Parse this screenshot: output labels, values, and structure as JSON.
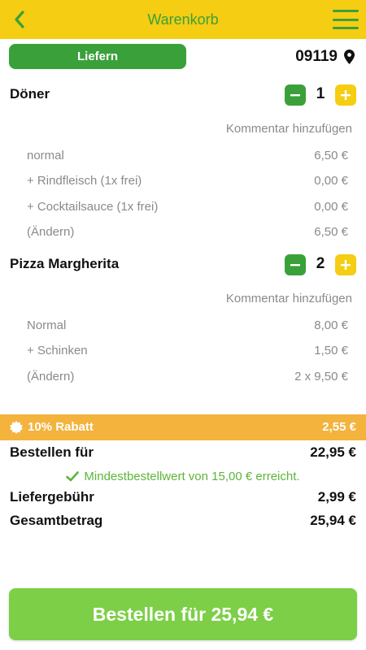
{
  "header": {
    "title": "Warenkorb",
    "back_icon": "chevron-left-icon",
    "menu_icon": "hamburger-menu-icon"
  },
  "topbar": {
    "delivery_label": "Liefern",
    "postcode": "09119",
    "location_icon": "location-pin-icon"
  },
  "items": [
    {
      "name": "Döner",
      "quantity": "1",
      "comment_label": "Kommentar hinzufügen",
      "lines": [
        {
          "label": "normal",
          "price": "6,50 €"
        },
        {
          "label": "+ Rindfleisch (1x frei)",
          "price": "0,00 €"
        },
        {
          "label": "+ Cocktailsauce (1x frei)",
          "price": "0,00 €"
        },
        {
          "label": "(Ändern)",
          "price": "6,50 €"
        }
      ]
    },
    {
      "name": "Pizza Margherita",
      "quantity": "2",
      "comment_label": "Kommentar hinzufügen",
      "lines": [
        {
          "label": "Normal",
          "price": "8,00 €"
        },
        {
          "label": "+ Schinken",
          "price": "1,50 €"
        },
        {
          "label": "(Ändern)",
          "price": "2 x 9,50 €"
        }
      ]
    }
  ],
  "discount": {
    "label": "10% Rabatt",
    "amount": "2,55 €",
    "icon": "discount-badge-icon"
  },
  "summary": {
    "order_for_label": "Bestellen für",
    "order_for_value": "22,95 €",
    "min_order_note": "Mindestbestellwert von 15,00 € erreicht.",
    "delivery_fee_label": "Liefergebühr",
    "delivery_fee_value": "2,99 €",
    "total_label": "Gesamtbetrag",
    "total_value": "25,94 €"
  },
  "order_button": {
    "label": "Bestellen für 25,94 €"
  },
  "colors": {
    "header_bg": "#f5cd12",
    "primary_green": "#3aa13a",
    "order_button_green": "#7ccf47",
    "discount_orange": "#f3b33d",
    "muted_text": "#8a8a8a"
  }
}
